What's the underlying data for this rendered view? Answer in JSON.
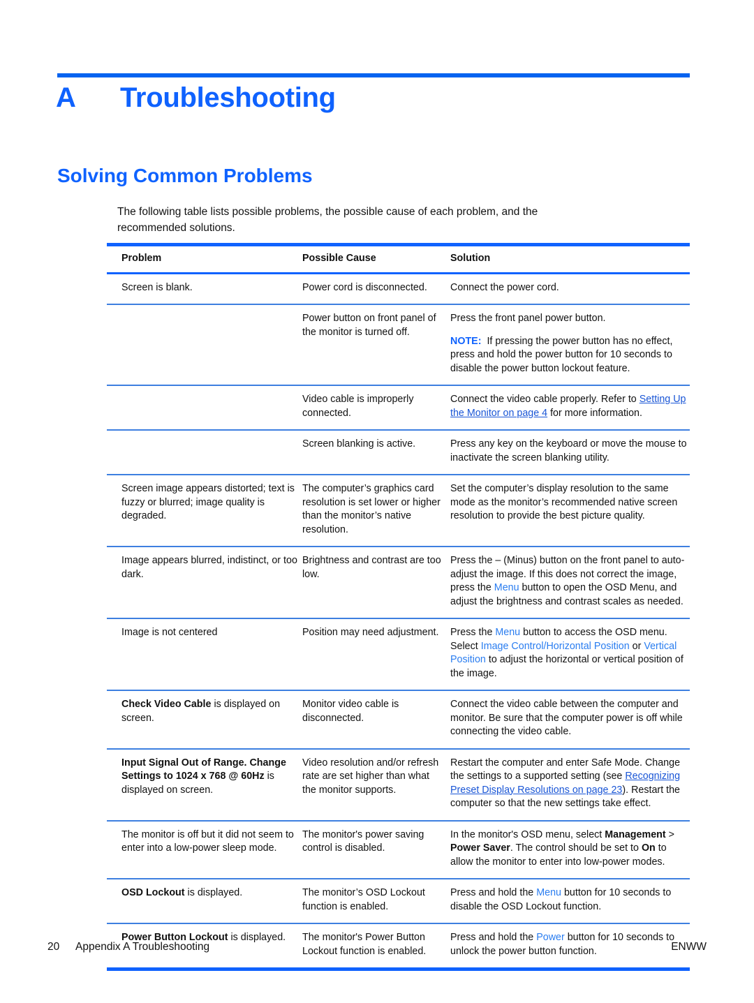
{
  "colors": {
    "accent": "#0f62fe",
    "link": "#1a56d6",
    "ui_reference": "#2a7df0",
    "text": "#111111"
  },
  "chapter": {
    "letter": "A",
    "title": "Troubleshooting"
  },
  "section": {
    "title": "Solving Common Problems"
  },
  "intro": {
    "text": "The following table lists possible problems, the possible cause of each problem, and the recommended solutions."
  },
  "table": {
    "headers": [
      "Problem",
      "Possible Cause",
      "Solution"
    ],
    "rows": [
      {
        "problem_plain": "Screen is blank.",
        "cause_plain": "Power cord is disconnected.",
        "solution_plain": "Connect the power cord."
      },
      {
        "problem_plain": "",
        "cause_plain": "Power button on front panel of the monitor is turned off.",
        "solution_plain": "Press the front panel power button.",
        "solution_note_label": "NOTE:",
        "solution_note_text": "If pressing the power button has no effect, press and hold the power button for 10 seconds to disable the power button lockout feature."
      },
      {
        "problem_plain": "",
        "cause_plain": "Video cable is improperly connected.",
        "solution_pre": "Connect the video cable properly. Refer to ",
        "solution_link": "Setting Up the Monitor on page 4",
        "solution_post": " for more information."
      },
      {
        "problem_plain": "",
        "cause_plain": "Screen blanking is active.",
        "solution_plain": "Press any key on the keyboard or move the mouse to inactivate the screen blanking utility."
      },
      {
        "problem_plain": "Screen image appears distorted; text is fuzzy or blurred; image quality is degraded.",
        "cause_plain": "The computer’s graphics card resolution is set lower or higher than the monitor’s native resolution.",
        "solution_plain": "Set the computer’s display resolution to the same mode as the monitor’s recommended native screen resolution to provide the best picture quality."
      },
      {
        "problem_plain": "Image appears blurred, indistinct, or too dark.",
        "cause_plain": "Brightness and contrast are too low.",
        "solution_pre": "Press the – (Minus) button on the front panel to auto-adjust the image. If this does not correct the image, press the ",
        "solution_ui": "Menu",
        "solution_post": " button to open the OSD Menu, and adjust the brightness and contrast scales as needed."
      },
      {
        "problem_plain": "Image is not centered",
        "cause_plain": "Position may need adjustment.",
        "solution_pre": "Press the ",
        "solution_ui": "Menu",
        "solution_mid": " button to access the OSD menu. Select ",
        "solution_ui2": "Image Control/Horizontal Position",
        "solution_mid2": " or ",
        "solution_ui3": "Vertical Position",
        "solution_post": " to adjust the horizontal or vertical position of the image."
      },
      {
        "problem_bold": "Check Video Cable",
        "problem_post": " is displayed on screen.",
        "cause_plain": "Monitor video cable is disconnected.",
        "solution_plain": "Connect the video cable between the computer and monitor. Be sure that the computer power is off while connecting the video cable."
      },
      {
        "problem_bold": "Input Signal Out of Range. Change Settings to 1024 x 768 @ 60Hz",
        "problem_post": " is displayed on screen.",
        "cause_plain": "Video resolution and/or refresh rate are set higher than what the monitor supports.",
        "solution_pre": "Restart the computer and enter Safe Mode. Change the settings to a supported setting (see ",
        "solution_link": "Recognizing Preset Display Resolutions on page 23",
        "solution_post": "). Restart the computer so that the new settings take effect."
      },
      {
        "problem_plain": "The monitor is off but it did not seem to enter into a low-power sleep mode.",
        "cause_plain": "The monitor's power saving control is disabled.",
        "solution_pre": "In the monitor's OSD menu, select ",
        "solution_b1": "Management",
        "solution_mid": " > ",
        "solution_b2": "Power Saver",
        "solution_mid2": ". The control should be set to ",
        "solution_b3": "On",
        "solution_post": " to allow the monitor to enter into low-power modes."
      },
      {
        "problem_bold": "OSD Lockout",
        "problem_post": " is displayed.",
        "cause_plain": "The monitor’s OSD Lockout function is enabled.",
        "solution_pre": "Press and hold the ",
        "solution_ui": "Menu",
        "solution_post": " button for 10 seconds to disable the OSD Lockout function."
      },
      {
        "problem_bold": "Power Button Lockout",
        "problem_post": " is displayed.",
        "cause_plain": "The monitor's Power Button Lockout function is enabled.",
        "solution_pre": "Press and hold the ",
        "solution_ui": "Power",
        "solution_post": " button for 10 seconds to unlock the power button function."
      }
    ]
  },
  "footer": {
    "page_number": "20",
    "title": "Appendix A   Troubleshooting",
    "locale": "ENWW"
  }
}
